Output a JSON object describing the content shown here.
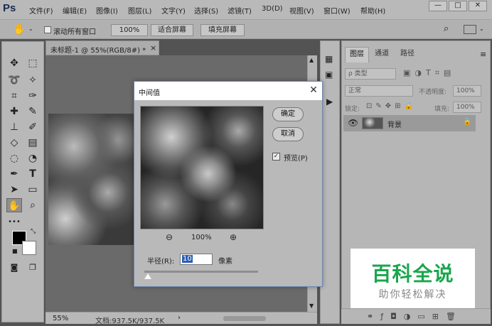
{
  "app": {
    "logo": "Ps"
  },
  "menu": [
    "文件(F)",
    "编辑(E)",
    "图像(I)",
    "图层(L)",
    "文字(Y)",
    "选择(S)",
    "滤镜(T)",
    "3D(D)",
    "视图(V)",
    "窗口(W)",
    "帮助(H)"
  ],
  "window_controls": {
    "minimize": "—",
    "maximize": "□",
    "close": "✕"
  },
  "options": {
    "scroll_all_label": "滚动所有窗口",
    "zoom_100": "100%",
    "fit_screen": "适合屏幕",
    "fill_screen": "填充屏幕"
  },
  "document": {
    "tab_title": "未标题-1 @ 55%(RGB/8#) *",
    "tab_close": "×",
    "zoom": "55%",
    "doc_info": "文档:937.5K/937.5K"
  },
  "dialog": {
    "title": "中间值",
    "ok": "确定",
    "cancel": "取消",
    "preview_label": "预览(P)",
    "preview_checked": true,
    "zoom_out": "⊖",
    "zoom_level": "100%",
    "zoom_in": "⊕",
    "radius_label": "半径(R):",
    "radius_value": "10",
    "radius_unit": "像素",
    "radius_fraction": 0.02
  },
  "layers_panel": {
    "tabs": [
      "图层",
      "通道",
      "路径"
    ],
    "filter_kind": "ρ 类型",
    "blend_mode": "正常",
    "opacity_label": "不透明度:",
    "opacity_value": "100%",
    "lock_label": "锁定:",
    "fill_label": "填充:",
    "fill_value": "100%",
    "layer_name": "背景"
  },
  "watermark": {
    "title": "百科全说",
    "subtitle": "助你轻松解决"
  }
}
